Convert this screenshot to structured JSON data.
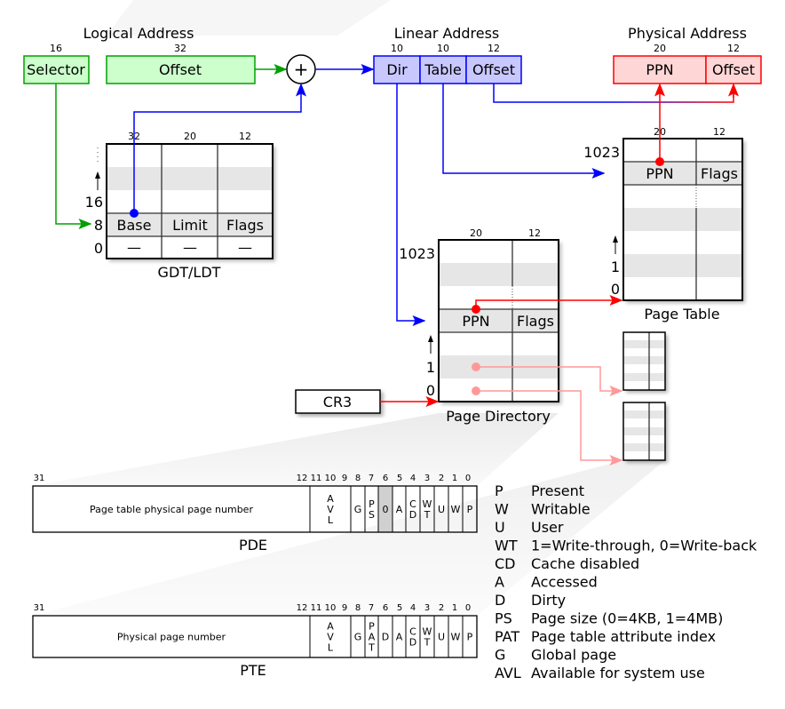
{
  "logical": {
    "title": "Logical Address",
    "selector_bits": "16",
    "offset_bits": "32",
    "selector": "Selector",
    "offset": "Offset",
    "color": "#00a000",
    "fill": "#ccffcc"
  },
  "linear": {
    "title": "Linear Address",
    "dir_bits": "10",
    "table_bits": "10",
    "offset_bits": "12",
    "dir": "Dir",
    "table": "Table",
    "offset": "Offset",
    "color": "#0000ff",
    "fill": "#c8c8ff"
  },
  "physical": {
    "title": "Physical Address",
    "ppn_bits": "20",
    "offset_bits": "12",
    "ppn": "PPN",
    "offset": "Offset",
    "color": "#ff0000",
    "fill": "#ffd6d6"
  },
  "adder": {
    "symbol": "+"
  },
  "gdt": {
    "caption": "GDT/LDT",
    "col_bits": [
      "32",
      "20",
      "12"
    ],
    "row_labels": [
      "16",
      "8",
      "0"
    ],
    "cells": [
      "Base",
      "Limit",
      "Flags"
    ],
    "empty": "—"
  },
  "page_directory": {
    "caption": "Page Directory",
    "col_bits": [
      "20",
      "12"
    ],
    "top_label": "1023",
    "row_labels": [
      "1",
      "0"
    ],
    "cells": [
      "PPN",
      "Flags"
    ]
  },
  "page_table": {
    "caption": "Page Table",
    "col_bits": [
      "20",
      "12"
    ],
    "top_label": "1023",
    "row_labels": [
      "1",
      "0"
    ],
    "cells": [
      "PPN",
      "Flags"
    ]
  },
  "cr3": {
    "label": "CR3"
  },
  "pde": {
    "caption": "PDE",
    "main_field": "Page table physical page number",
    "bits": [
      "31",
      "12",
      "11",
      "10",
      "9",
      "8",
      "7",
      "6",
      "5",
      "4",
      "3",
      "2",
      "1",
      "0"
    ],
    "fields": [
      "A\nV\nL",
      "G",
      "P\nS",
      "0",
      "A",
      "C\nD",
      "W\nT",
      "U",
      "W",
      "P"
    ]
  },
  "pte": {
    "caption": "PTE",
    "main_field": "Physical page number",
    "bits": [
      "31",
      "12",
      "11",
      "10",
      "9",
      "8",
      "7",
      "6",
      "5",
      "4",
      "3",
      "2",
      "1",
      "0"
    ],
    "fields": [
      "A\nV\nL",
      "G",
      "P\nA\nT",
      "D",
      "A",
      "C\nD",
      "W\nT",
      "U",
      "W",
      "P"
    ]
  },
  "legend": [
    {
      "abbr": "P",
      "desc": "Present"
    },
    {
      "abbr": "W",
      "desc": "Writable"
    },
    {
      "abbr": "U",
      "desc": "User"
    },
    {
      "abbr": "WT",
      "desc": "1=Write-through, 0=Write-back"
    },
    {
      "abbr": "CD",
      "desc": "Cache disabled"
    },
    {
      "abbr": "A",
      "desc": "Accessed"
    },
    {
      "abbr": "D",
      "desc": "Dirty"
    },
    {
      "abbr": "PS",
      "desc": "Page size (0=4KB, 1=4MB)"
    },
    {
      "abbr": "PAT",
      "desc": "Page table attribute index"
    },
    {
      "abbr": "G",
      "desc": "Global page"
    },
    {
      "abbr": "AVL",
      "desc": "Available for system use"
    }
  ]
}
